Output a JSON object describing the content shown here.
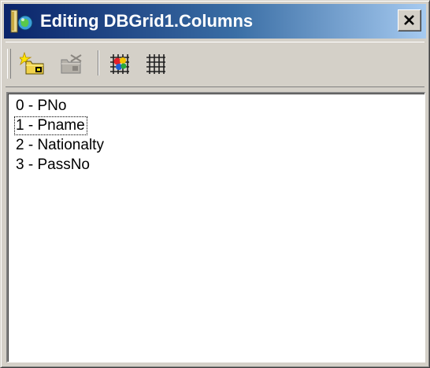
{
  "window": {
    "title": "Editing DBGrid1.Columns"
  },
  "title_bar": {
    "app_icon": "delphi-app-icon",
    "close_icon": "close-x-icon"
  },
  "toolbar": {
    "buttons": [
      {
        "name": "add-new-icon",
        "enabled": true
      },
      {
        "name": "delete-selected-icon",
        "enabled": false
      },
      {
        "name": "add-all-fields-icon",
        "enabled": true
      },
      {
        "name": "restore-defaults-icon",
        "enabled": true
      }
    ]
  },
  "columns_list": {
    "items": [
      "0 - PNo",
      "1 - Pname",
      "2 - Nationalty",
      "3 - PassNo"
    ],
    "focused_index": 1
  },
  "colors": {
    "title_gradient_start": "#0a246a",
    "title_gradient_end": "#a6caf0",
    "face": "#d4d0c8"
  }
}
